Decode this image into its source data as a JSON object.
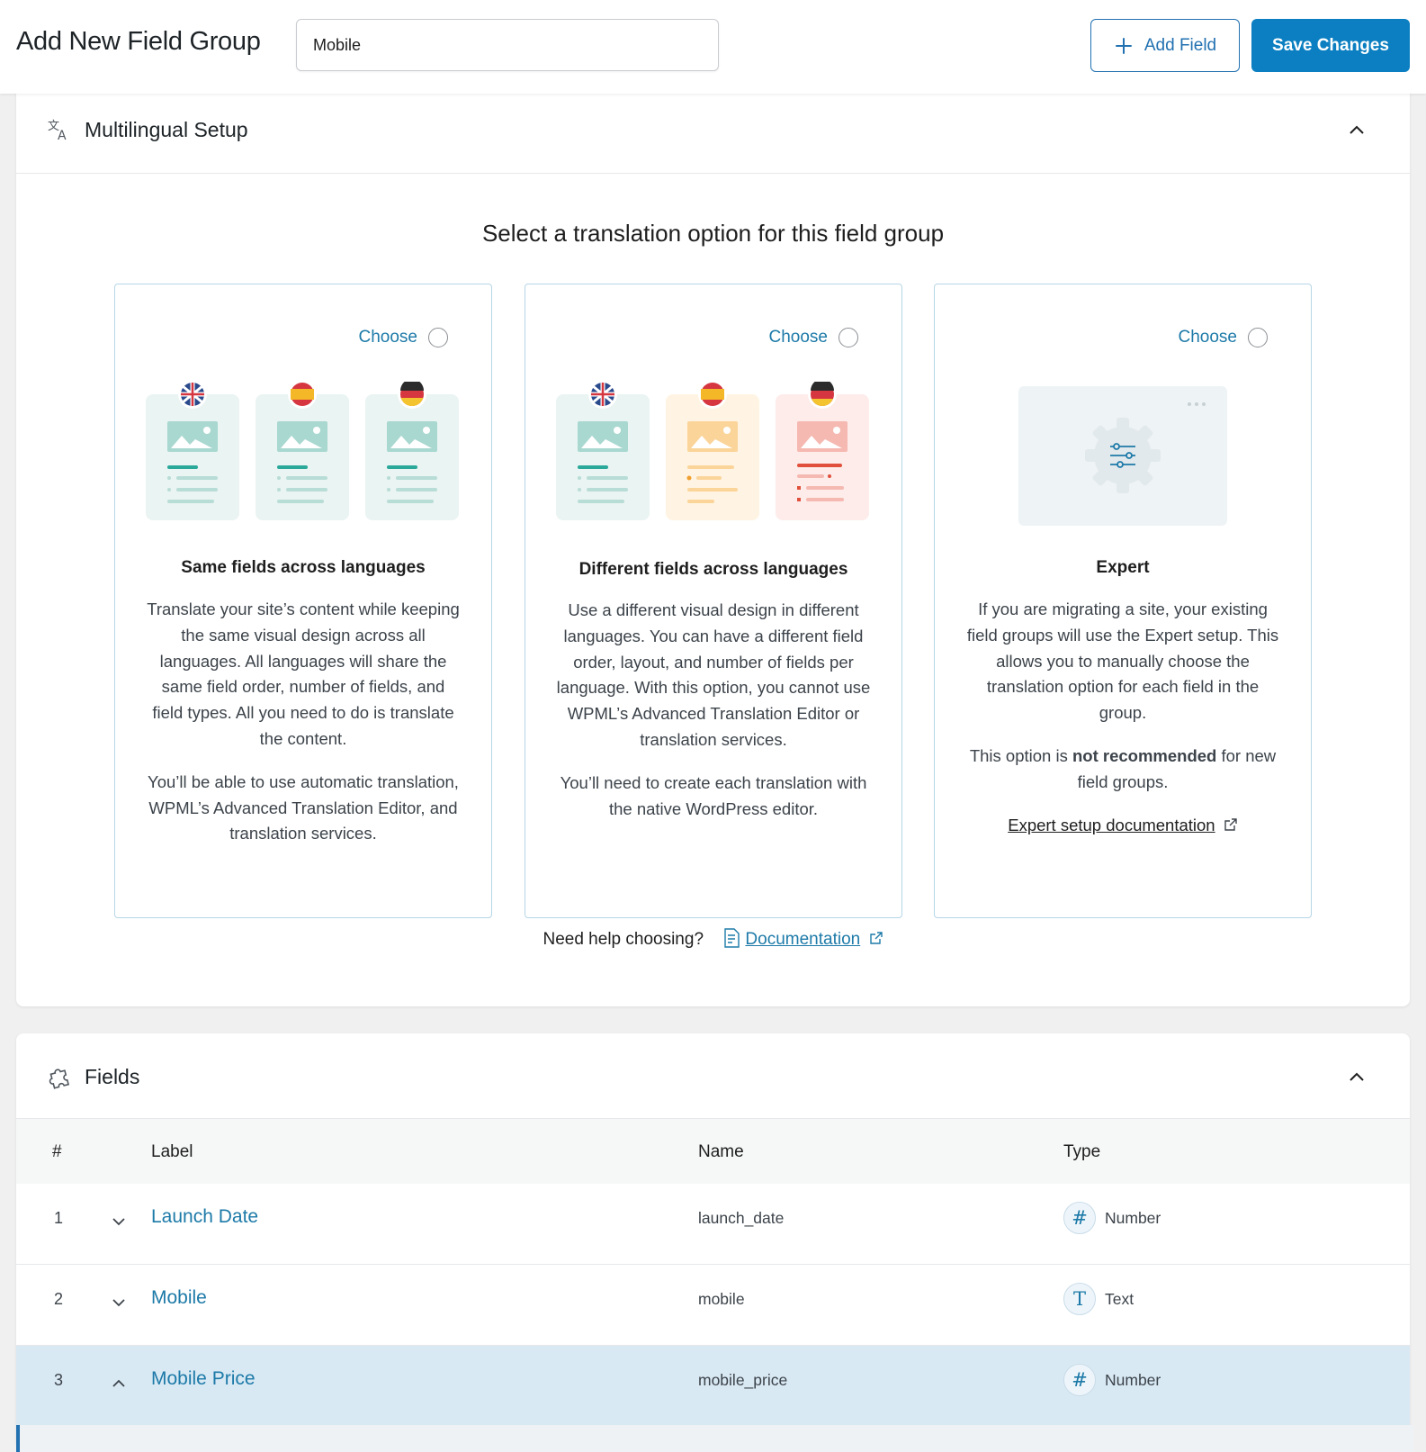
{
  "header": {
    "title": "Add New Field Group",
    "group_title_value": "Mobile",
    "add_field_label": "Add Field",
    "save_label": "Save Changes"
  },
  "multilingual": {
    "title": "Multilingual Setup",
    "heading": "Select a translation option for this field group",
    "choose_label": "Choose",
    "options": [
      {
        "title": "Same fields across languages",
        "paragraphs": [
          "Translate your site’s content while keeping the same visual design across all languages. All languages will share the same field order, number of fields, and field types. All you need to do is translate the content.",
          "You’ll be able to use automatic translation, WPML’s Advanced Translation Editor, and translation services."
        ]
      },
      {
        "title": "Different fields across languages",
        "paragraphs": [
          "Use a different visual design in different languages. You can have a different field order, layout, and number of fields per language. With this option, you cannot use WPML’s Advanced Translation Editor or translation services.",
          "You’ll need to create each translation with the native WordPress editor."
        ]
      },
      {
        "title": "Expert",
        "paragraph1": "If you are migrating a site, your existing field groups will use the Expert setup. This allows you to manually choose the translation option for each field in the group.",
        "p2_before": "This option is ",
        "p2_bold": "not recommended",
        "p2_after": " for new field groups.",
        "link": "Expert setup documentation"
      }
    ],
    "help_text": "Need help choosing?",
    "help_link": "Documentation"
  },
  "fields": {
    "title": "Fields",
    "columns": [
      "#",
      "Label",
      "Name",
      "Type"
    ],
    "rows": [
      {
        "num": "1",
        "label": "Launch Date",
        "name": "launch_date",
        "type": "Number",
        "type_icon": "#"
      },
      {
        "num": "2",
        "label": "Mobile",
        "name": "mobile",
        "type": "Text",
        "type_icon": "T"
      },
      {
        "num": "3",
        "label": "Mobile Price",
        "name": "mobile_price",
        "type": "Number",
        "type_icon": "#"
      }
    ]
  },
  "colors": {
    "accent": "#0b7fc1",
    "link": "#1d7aa8",
    "selected_row": "#d9e9f4"
  }
}
